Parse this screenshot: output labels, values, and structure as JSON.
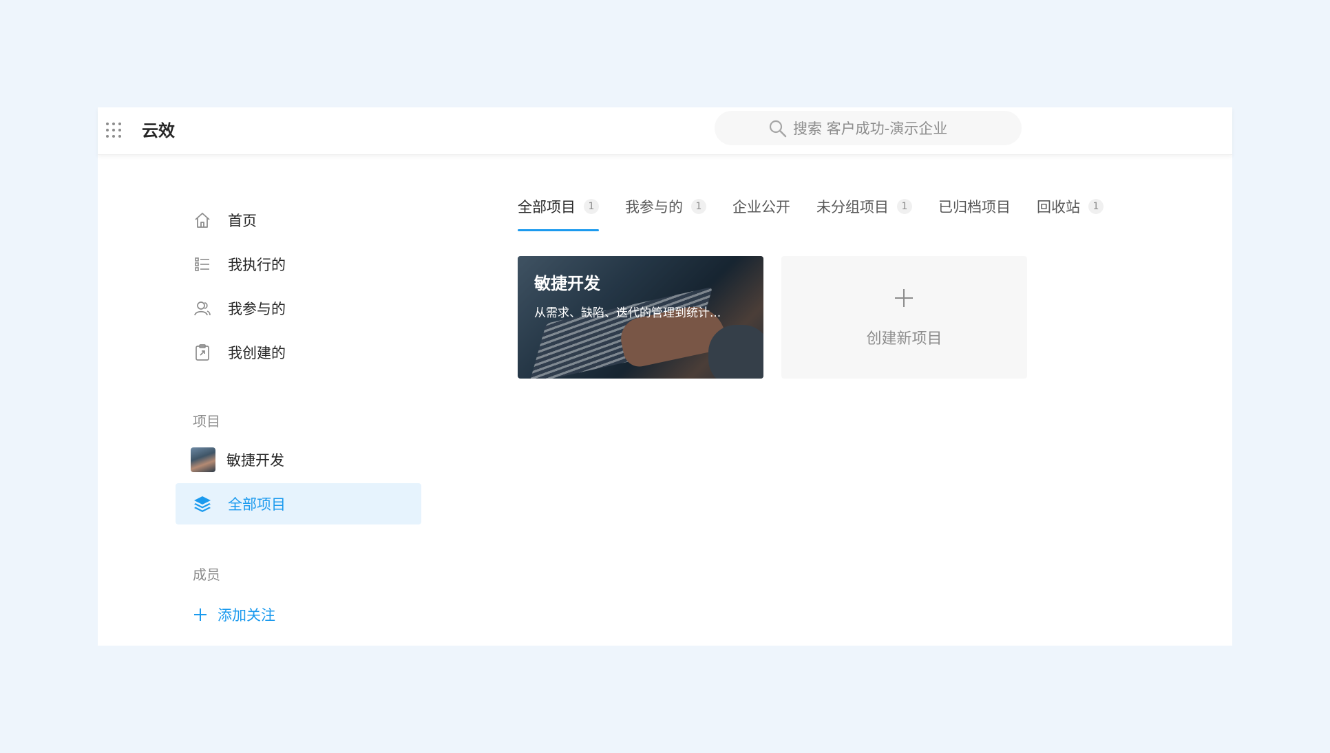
{
  "header": {
    "app_title": "云效",
    "search_placeholder": "搜索 客户成功-演示企业"
  },
  "sidebar": {
    "items": [
      {
        "label": "首页",
        "icon": "home-icon"
      },
      {
        "label": "我执行的",
        "icon": "checklist-icon"
      },
      {
        "label": "我参与的",
        "icon": "users-icon"
      },
      {
        "label": "我创建的",
        "icon": "clipboard-icon"
      }
    ],
    "projects_section_label": "项目",
    "project_item": {
      "label": "敏捷开发"
    },
    "all_projects_item": {
      "label": "全部项目",
      "icon": "layers-icon"
    },
    "members_section_label": "成员",
    "add_follow_label": "添加关注"
  },
  "tabs": [
    {
      "label": "全部项目",
      "count": "1",
      "active": true
    },
    {
      "label": "我参与的",
      "count": "1"
    },
    {
      "label": "企业公开"
    },
    {
      "label": "未分组项目",
      "count": "1"
    },
    {
      "label": "已归档项目"
    },
    {
      "label": "回收站",
      "count": "1"
    }
  ],
  "project_card": {
    "title": "敏捷开发",
    "description": "从需求、缺陷、迭代的管理到统计..."
  },
  "create_card": {
    "label": "创建新项目"
  },
  "colors": {
    "accent": "#1b9aee",
    "active_bg": "#e6f3fd",
    "page_bg": "#eef5fc"
  }
}
